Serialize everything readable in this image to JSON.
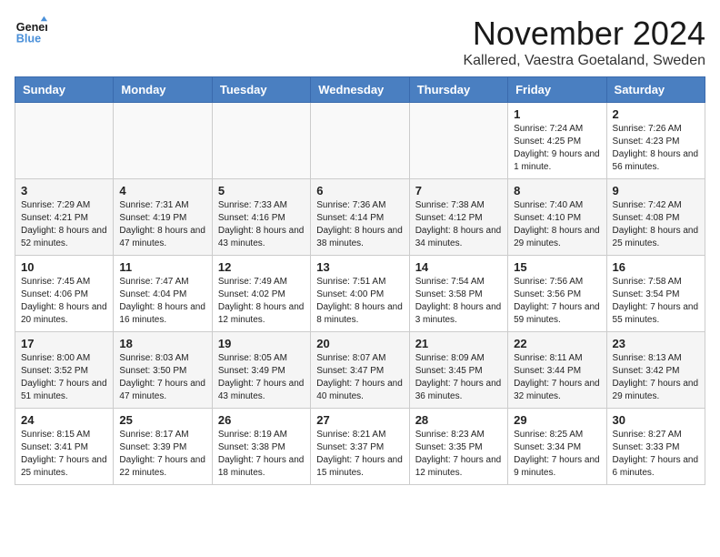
{
  "logo": {
    "line1": "General",
    "line2": "Blue"
  },
  "title": "November 2024",
  "location": "Kallered, Vaestra Goetaland, Sweden",
  "headers": [
    "Sunday",
    "Monday",
    "Tuesday",
    "Wednesday",
    "Thursday",
    "Friday",
    "Saturday"
  ],
  "weeks": [
    [
      {
        "day": "",
        "sunrise": "",
        "sunset": "",
        "daylight": ""
      },
      {
        "day": "",
        "sunrise": "",
        "sunset": "",
        "daylight": ""
      },
      {
        "day": "",
        "sunrise": "",
        "sunset": "",
        "daylight": ""
      },
      {
        "day": "",
        "sunrise": "",
        "sunset": "",
        "daylight": ""
      },
      {
        "day": "",
        "sunrise": "",
        "sunset": "",
        "daylight": ""
      },
      {
        "day": "1",
        "sunrise": "Sunrise: 7:24 AM",
        "sunset": "Sunset: 4:25 PM",
        "daylight": "Daylight: 9 hours and 1 minute."
      },
      {
        "day": "2",
        "sunrise": "Sunrise: 7:26 AM",
        "sunset": "Sunset: 4:23 PM",
        "daylight": "Daylight: 8 hours and 56 minutes."
      }
    ],
    [
      {
        "day": "3",
        "sunrise": "Sunrise: 7:29 AM",
        "sunset": "Sunset: 4:21 PM",
        "daylight": "Daylight: 8 hours and 52 minutes."
      },
      {
        "day": "4",
        "sunrise": "Sunrise: 7:31 AM",
        "sunset": "Sunset: 4:19 PM",
        "daylight": "Daylight: 8 hours and 47 minutes."
      },
      {
        "day": "5",
        "sunrise": "Sunrise: 7:33 AM",
        "sunset": "Sunset: 4:16 PM",
        "daylight": "Daylight: 8 hours and 43 minutes."
      },
      {
        "day": "6",
        "sunrise": "Sunrise: 7:36 AM",
        "sunset": "Sunset: 4:14 PM",
        "daylight": "Daylight: 8 hours and 38 minutes."
      },
      {
        "day": "7",
        "sunrise": "Sunrise: 7:38 AM",
        "sunset": "Sunset: 4:12 PM",
        "daylight": "Daylight: 8 hours and 34 minutes."
      },
      {
        "day": "8",
        "sunrise": "Sunrise: 7:40 AM",
        "sunset": "Sunset: 4:10 PM",
        "daylight": "Daylight: 8 hours and 29 minutes."
      },
      {
        "day": "9",
        "sunrise": "Sunrise: 7:42 AM",
        "sunset": "Sunset: 4:08 PM",
        "daylight": "Daylight: 8 hours and 25 minutes."
      }
    ],
    [
      {
        "day": "10",
        "sunrise": "Sunrise: 7:45 AM",
        "sunset": "Sunset: 4:06 PM",
        "daylight": "Daylight: 8 hours and 20 minutes."
      },
      {
        "day": "11",
        "sunrise": "Sunrise: 7:47 AM",
        "sunset": "Sunset: 4:04 PM",
        "daylight": "Daylight: 8 hours and 16 minutes."
      },
      {
        "day": "12",
        "sunrise": "Sunrise: 7:49 AM",
        "sunset": "Sunset: 4:02 PM",
        "daylight": "Daylight: 8 hours and 12 minutes."
      },
      {
        "day": "13",
        "sunrise": "Sunrise: 7:51 AM",
        "sunset": "Sunset: 4:00 PM",
        "daylight": "Daylight: 8 hours and 8 minutes."
      },
      {
        "day": "14",
        "sunrise": "Sunrise: 7:54 AM",
        "sunset": "Sunset: 3:58 PM",
        "daylight": "Daylight: 8 hours and 3 minutes."
      },
      {
        "day": "15",
        "sunrise": "Sunrise: 7:56 AM",
        "sunset": "Sunset: 3:56 PM",
        "daylight": "Daylight: 7 hours and 59 minutes."
      },
      {
        "day": "16",
        "sunrise": "Sunrise: 7:58 AM",
        "sunset": "Sunset: 3:54 PM",
        "daylight": "Daylight: 7 hours and 55 minutes."
      }
    ],
    [
      {
        "day": "17",
        "sunrise": "Sunrise: 8:00 AM",
        "sunset": "Sunset: 3:52 PM",
        "daylight": "Daylight: 7 hours and 51 minutes."
      },
      {
        "day": "18",
        "sunrise": "Sunrise: 8:03 AM",
        "sunset": "Sunset: 3:50 PM",
        "daylight": "Daylight: 7 hours and 47 minutes."
      },
      {
        "day": "19",
        "sunrise": "Sunrise: 8:05 AM",
        "sunset": "Sunset: 3:49 PM",
        "daylight": "Daylight: 7 hours and 43 minutes."
      },
      {
        "day": "20",
        "sunrise": "Sunrise: 8:07 AM",
        "sunset": "Sunset: 3:47 PM",
        "daylight": "Daylight: 7 hours and 40 minutes."
      },
      {
        "day": "21",
        "sunrise": "Sunrise: 8:09 AM",
        "sunset": "Sunset: 3:45 PM",
        "daylight": "Daylight: 7 hours and 36 minutes."
      },
      {
        "day": "22",
        "sunrise": "Sunrise: 8:11 AM",
        "sunset": "Sunset: 3:44 PM",
        "daylight": "Daylight: 7 hours and 32 minutes."
      },
      {
        "day": "23",
        "sunrise": "Sunrise: 8:13 AM",
        "sunset": "Sunset: 3:42 PM",
        "daylight": "Daylight: 7 hours and 29 minutes."
      }
    ],
    [
      {
        "day": "24",
        "sunrise": "Sunrise: 8:15 AM",
        "sunset": "Sunset: 3:41 PM",
        "daylight": "Daylight: 7 hours and 25 minutes."
      },
      {
        "day": "25",
        "sunrise": "Sunrise: 8:17 AM",
        "sunset": "Sunset: 3:39 PM",
        "daylight": "Daylight: 7 hours and 22 minutes."
      },
      {
        "day": "26",
        "sunrise": "Sunrise: 8:19 AM",
        "sunset": "Sunset: 3:38 PM",
        "daylight": "Daylight: 7 hours and 18 minutes."
      },
      {
        "day": "27",
        "sunrise": "Sunrise: 8:21 AM",
        "sunset": "Sunset: 3:37 PM",
        "daylight": "Daylight: 7 hours and 15 minutes."
      },
      {
        "day": "28",
        "sunrise": "Sunrise: 8:23 AM",
        "sunset": "Sunset: 3:35 PM",
        "daylight": "Daylight: 7 hours and 12 minutes."
      },
      {
        "day": "29",
        "sunrise": "Sunrise: 8:25 AM",
        "sunset": "Sunset: 3:34 PM",
        "daylight": "Daylight: 7 hours and 9 minutes."
      },
      {
        "day": "30",
        "sunrise": "Sunrise: 8:27 AM",
        "sunset": "Sunset: 3:33 PM",
        "daylight": "Daylight: 7 hours and 6 minutes."
      }
    ]
  ]
}
